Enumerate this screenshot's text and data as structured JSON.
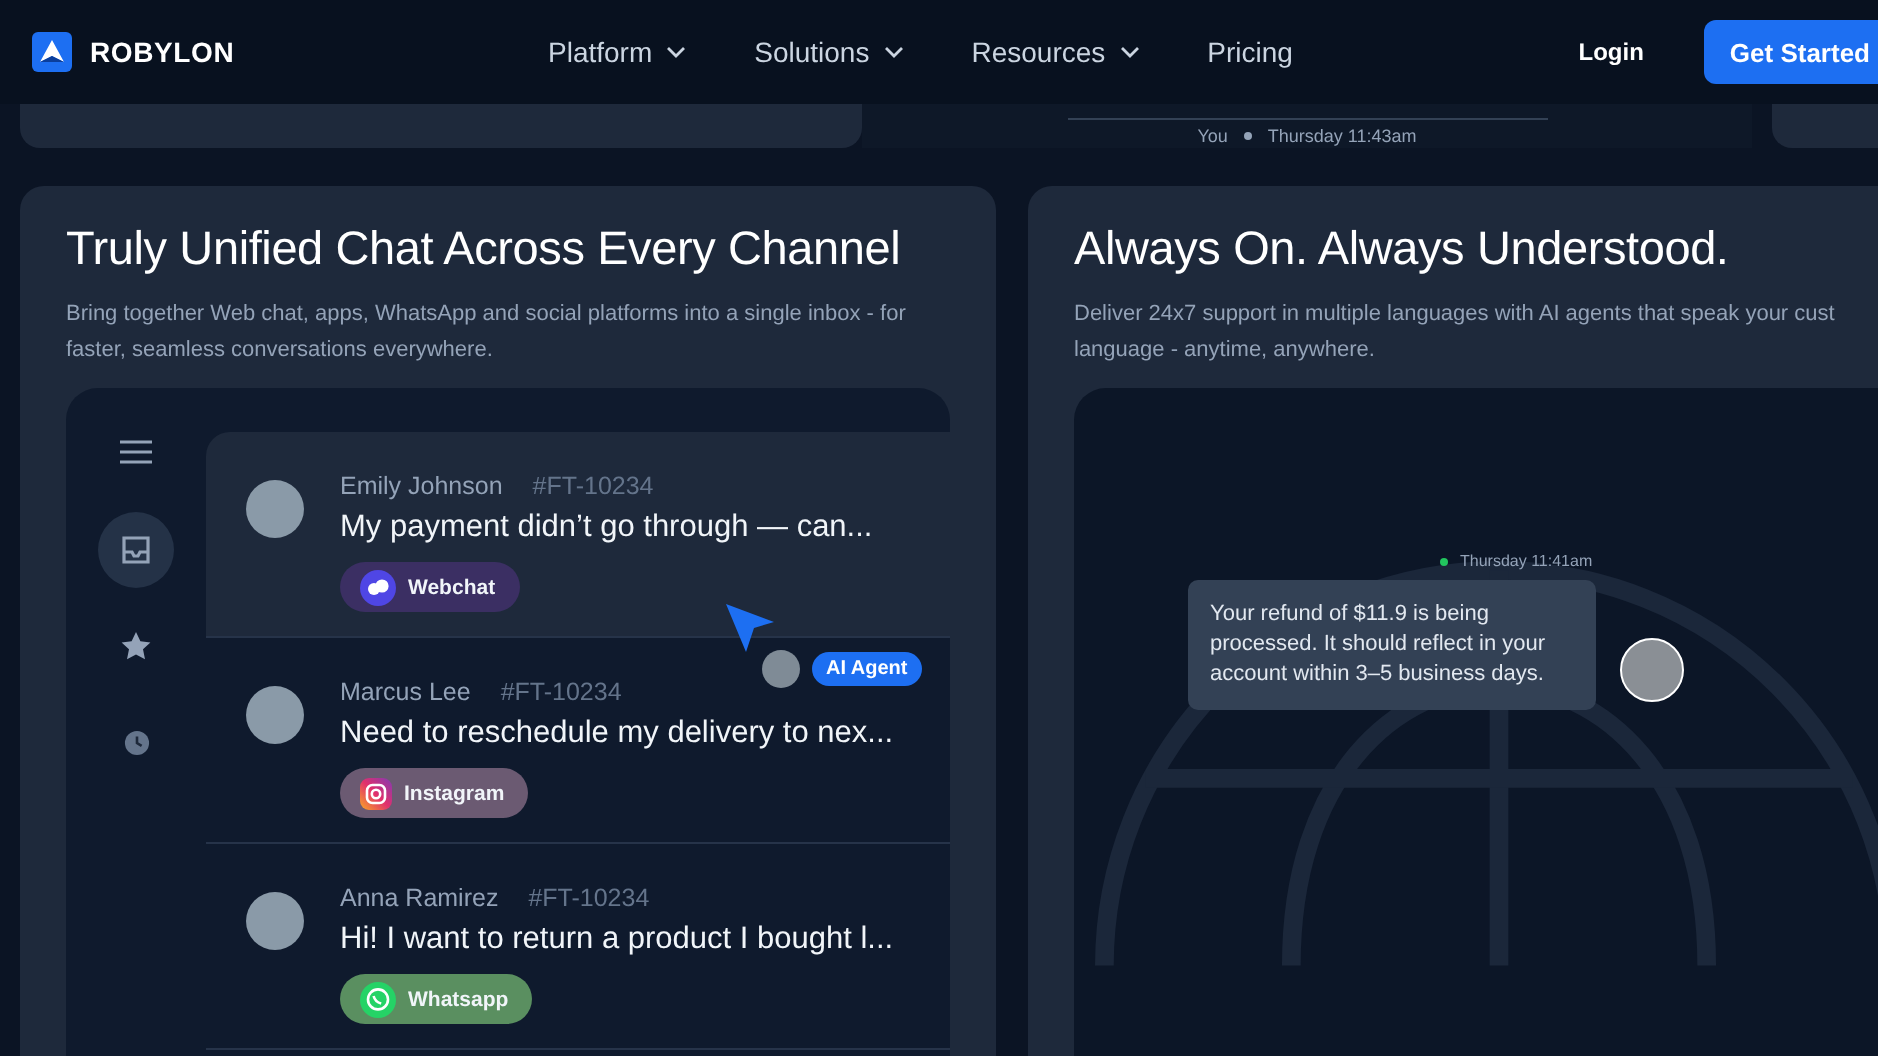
{
  "nav": {
    "brand": "ROBYLON",
    "links": [
      {
        "label": "Platform",
        "dropdown": true
      },
      {
        "label": "Solutions",
        "dropdown": true
      },
      {
        "label": "Resources",
        "dropdown": true
      },
      {
        "label": "Pricing",
        "dropdown": false
      }
    ],
    "login": "Login",
    "cta": "Get Started"
  },
  "top_strip": {
    "sender": "You",
    "time": "Thursday 11:43am"
  },
  "unified_card": {
    "title": "Truly Unified Chat Across Every Channel",
    "description": "Bring together Web chat, apps, WhatsApp and social platforms into a single inbox - for faster, seamless conversations everywhere.",
    "rail": [
      {
        "kind": "inbox",
        "selected": true
      },
      {
        "kind": "star",
        "selected": false
      },
      {
        "kind": "clock",
        "selected": false
      }
    ],
    "conversations": [
      {
        "name": "Emily Johnson",
        "ticket": "#FT-10234",
        "message": "My payment didn’t go through — can...",
        "channel": "Webchat",
        "kind": "webchat",
        "selected": true
      },
      {
        "name": "Marcus Lee",
        "ticket": "#FT-10234",
        "message": "Need to reschedule my delivery to nex...",
        "channel": "Instagram",
        "kind": "instagram",
        "selected": false
      },
      {
        "name": "Anna Ramirez",
        "ticket": "#FT-10234",
        "message": "Hi! I want to return a product I bought l...",
        "channel": "Whatsapp",
        "kind": "whatsapp",
        "selected": false
      }
    ],
    "agent_badge": "AI Agent"
  },
  "always_card": {
    "title": "Always On. Always Understood.",
    "description_lines": [
      "Deliver 24x7 support in multiple languages with AI agents that speak your cust",
      "language - anytime, anywhere."
    ],
    "timestamp": "Thursday 11:41am",
    "bubble": "Your refund of $11.9 is being processed. It should reflect in your account within 3–5 business days."
  }
}
